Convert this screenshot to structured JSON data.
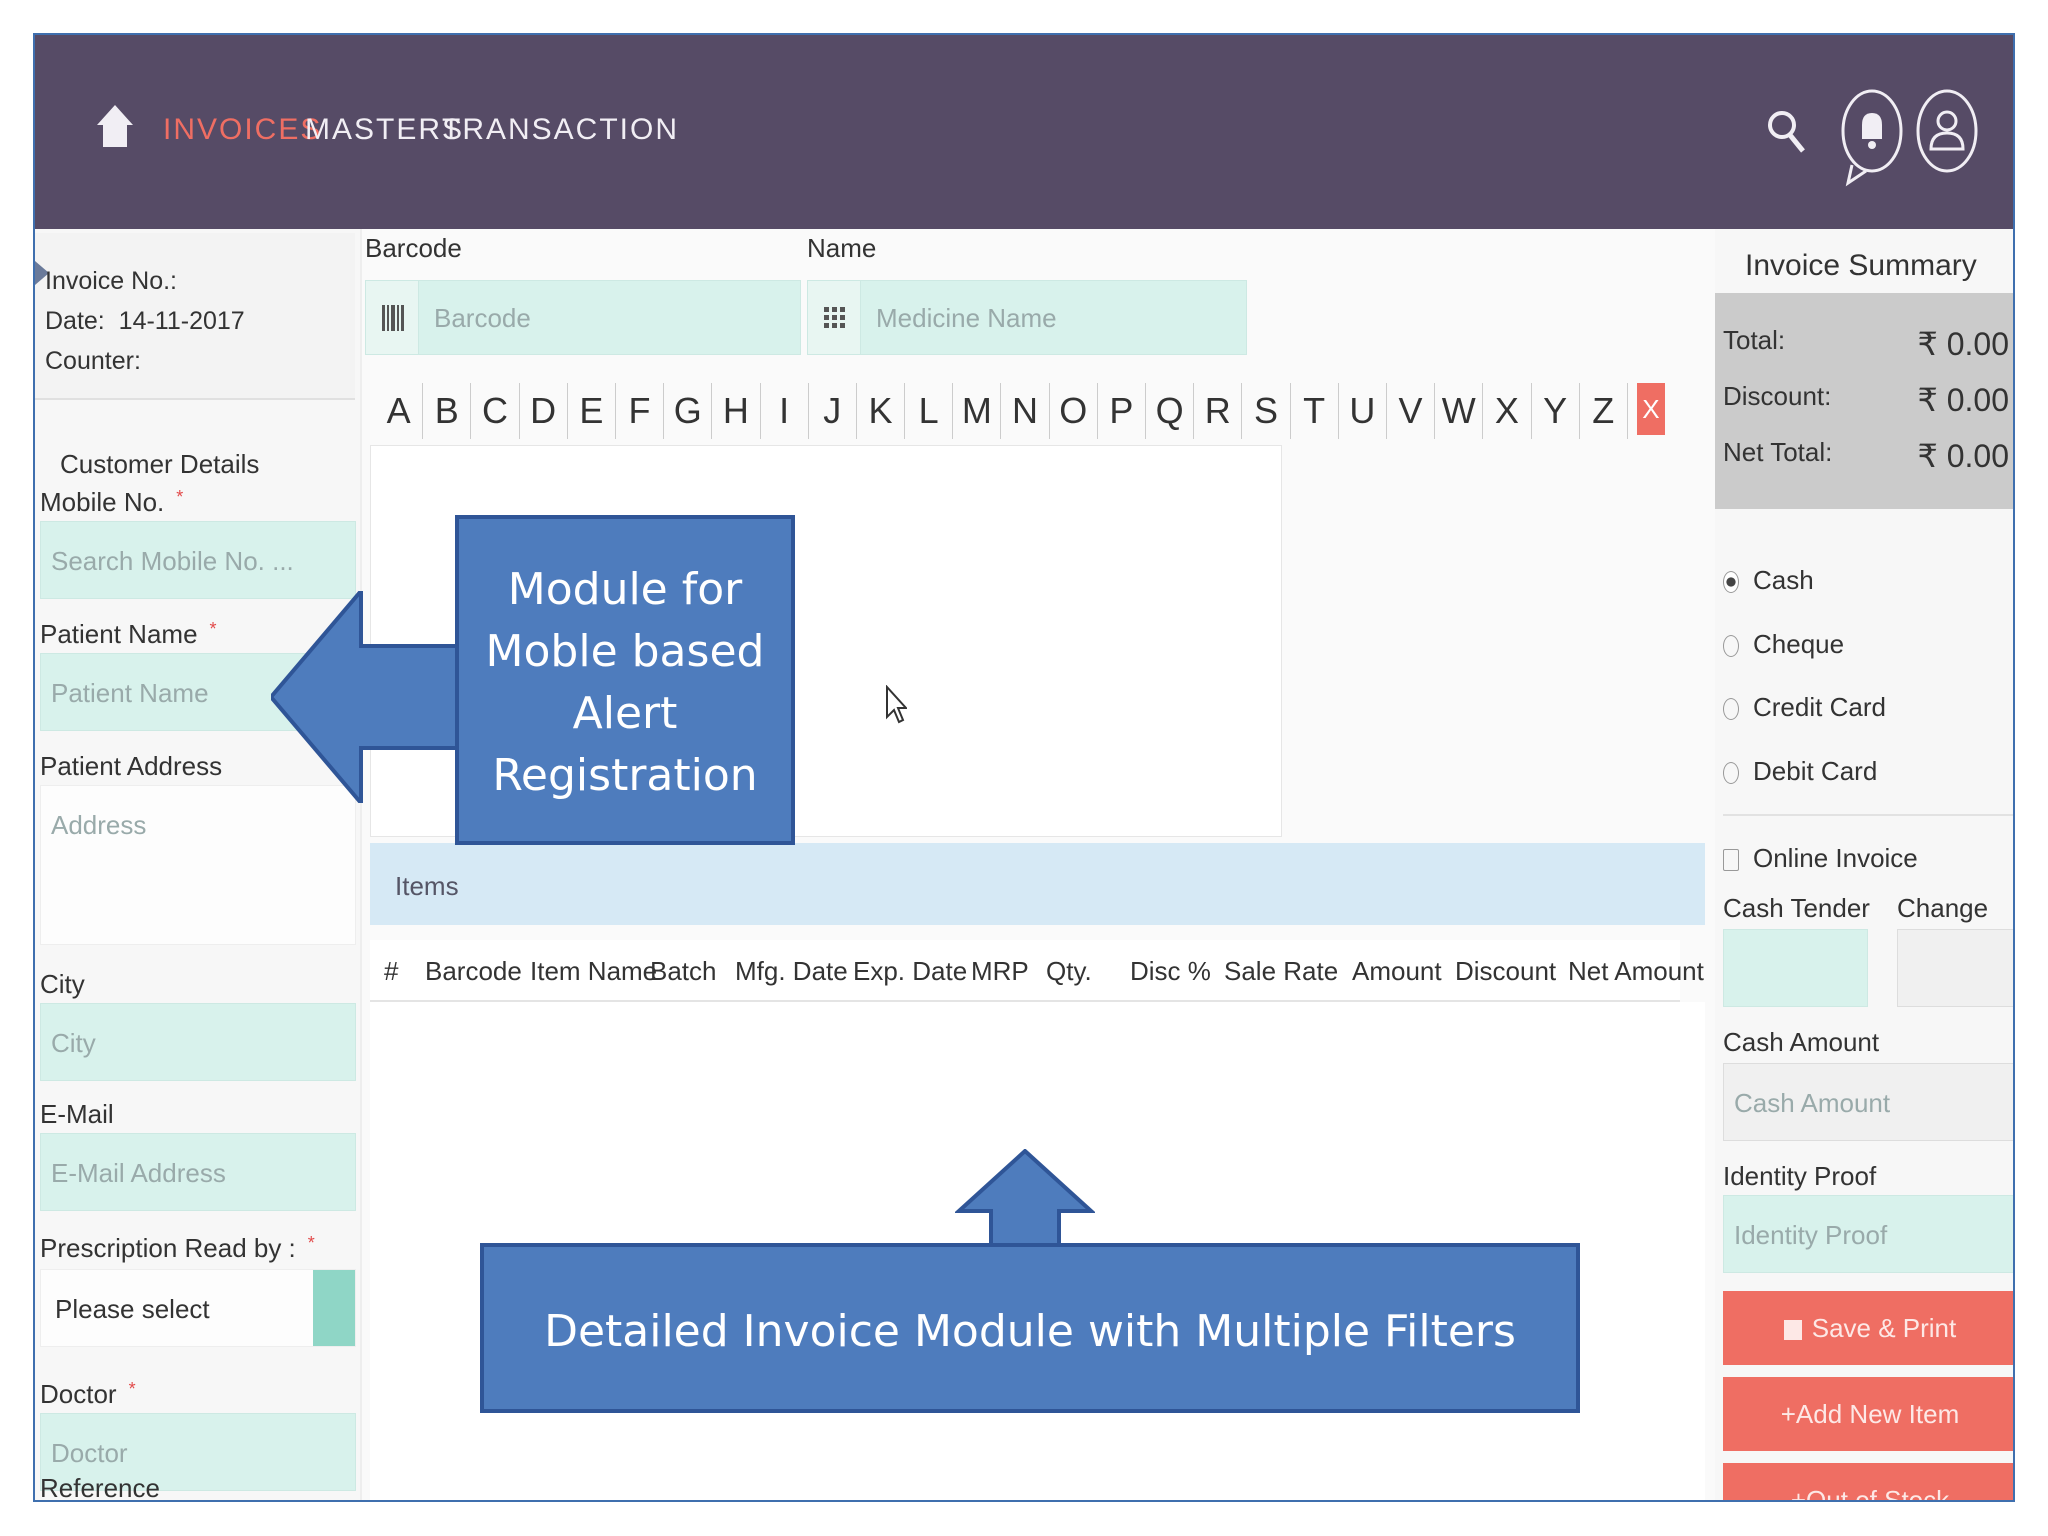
{
  "nav": {
    "items": [
      "INVOICES",
      "MASTERS",
      "TRANSACTION"
    ],
    "active": "INVOICES"
  },
  "icons": [
    "home-icon",
    "search-icon",
    "bell-icon",
    "user-icon",
    "barcode-icon",
    "grid-icon"
  ],
  "colors": {
    "topbar": "#564b66",
    "accent": "#ef6e63",
    "field": "#d8f2ec",
    "callout": "#4e7cbd"
  },
  "invoice_info": {
    "invoice_no_label": "Invoice No.:",
    "date_label": "Date:",
    "date_value": "14-11-2017",
    "counter_label": "Counter:"
  },
  "customer": {
    "section_title": "Customer Details",
    "mobile_label": "Mobile No.",
    "mobile_placeholder": "Search Mobile No. ...",
    "patient_name_label": "Patient Name",
    "patient_name_placeholder": "Patient Name",
    "patient_address_label": "Patient Address",
    "address_placeholder": "Address",
    "city_label": "City",
    "city_placeholder": "City",
    "email_label": "E-Mail",
    "email_placeholder": "E-Mail Address",
    "prescription_label": "Prescription Read by :",
    "prescription_value": "Please select",
    "doctor_label": "Doctor",
    "doctor_placeholder": "Doctor",
    "reference_label": "Reference",
    "required_mark": "*"
  },
  "search": {
    "barcode_label": "Barcode",
    "barcode_placeholder": "Barcode",
    "name_label": "Name",
    "name_placeholder": "Medicine Name",
    "alphabet": [
      "A",
      "B",
      "C",
      "D",
      "E",
      "F",
      "G",
      "H",
      "I",
      "J",
      "K",
      "L",
      "M",
      "N",
      "O",
      "P",
      "Q",
      "R",
      "S",
      "T",
      "U",
      "V",
      "W",
      "X",
      "Y",
      "Z"
    ],
    "clear_label": "X"
  },
  "items": {
    "title": "Items",
    "columns": [
      "#",
      "Barcode",
      "Item Name",
      "Batch",
      "Mfg. Date",
      "Exp. Date",
      "MRP",
      "Qty.",
      "Disc %",
      "Sale Rate",
      "Amount",
      "Discount",
      "Net Amount"
    ]
  },
  "summary": {
    "title": "Invoice Summary",
    "total_label": "Total:",
    "total_value": "₹ 0.00",
    "discount_label": "Discount:",
    "discount_value": "₹ 0.00",
    "net_label": "Net Total:",
    "net_value": "₹ 0.00",
    "payment_methods": [
      "Cash",
      "Cheque",
      "Credit Card",
      "Debit Card"
    ],
    "selected_payment": "Cash",
    "online_invoice_label": "Online Invoice",
    "cash_tender_label": "Cash Tender",
    "change_label": "Change",
    "cash_amount_label": "Cash Amount",
    "cash_amount_placeholder": "Cash Amount",
    "identity_label": "Identity Proof",
    "identity_placeholder": "Identity Proof",
    "save_print_label": "Save & Print",
    "add_item_label": "+Add New Item",
    "out_of_stock_label": "+Out of Stock"
  },
  "callouts": {
    "left": [
      "Module for",
      "Moble based",
      "Alert",
      "Registration"
    ],
    "bottom": "Detailed Invoice Module with Multiple Filters"
  }
}
